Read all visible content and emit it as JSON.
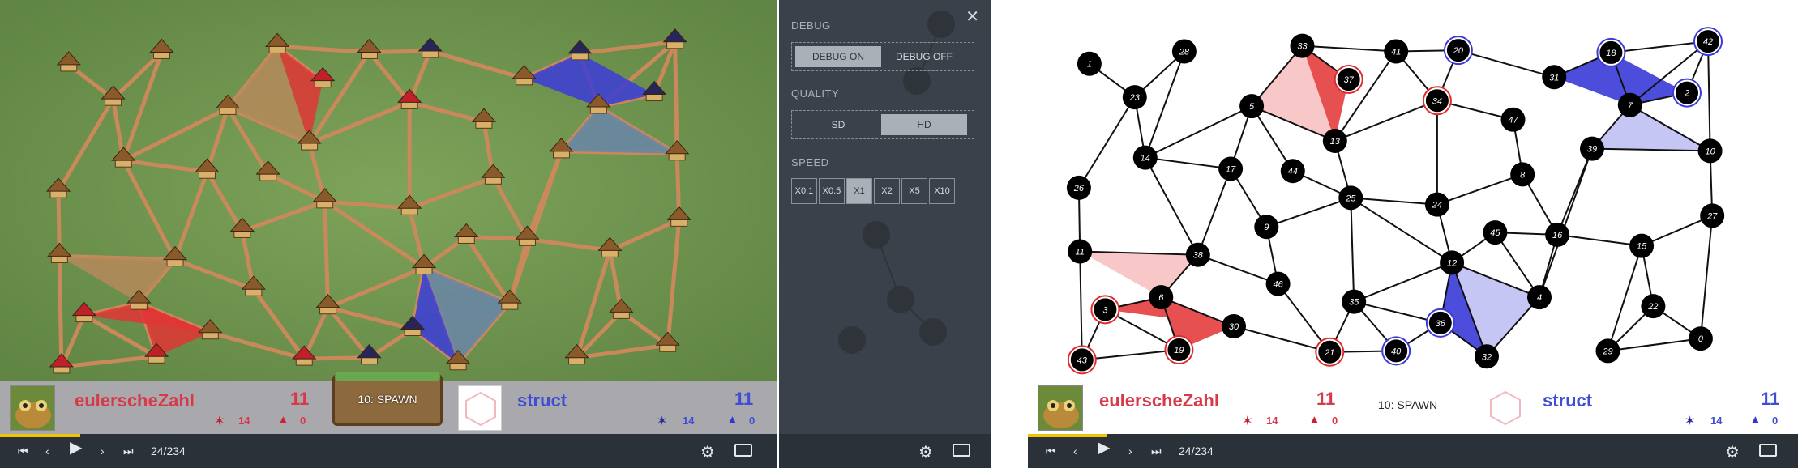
{
  "player_left": {
    "name": "eulerscheZahl",
    "score": "11",
    "units": "14",
    "ships": "0"
  },
  "player_right": {
    "name": "struct",
    "score": "11",
    "units": "14",
    "ships": "0"
  },
  "turn_label": "10: SPAWN",
  "frame_position": "24/234",
  "progress_fraction": 0.103,
  "debug_panel": {
    "debug_title": "DEBUG",
    "debug_on": "DEBUG ON",
    "debug_off": "DEBUG OFF",
    "quality_title": "QUALITY",
    "quality_sd": "SD",
    "quality_hd": "HD",
    "speed_title": "SPEED",
    "speeds": [
      "X0.1",
      "X0.5",
      "X1",
      "X2",
      "X5",
      "X10"
    ],
    "selected_speed": "X1"
  },
  "colors": {
    "red": "#e02a2a",
    "blue": "#3a3ad8",
    "node": "#000000",
    "progress": "#f5c400"
  },
  "graph": {
    "nodes": [
      {
        "id": "1"
      },
      {
        "id": "28"
      },
      {
        "id": "23"
      },
      {
        "id": "33"
      },
      {
        "id": "41"
      },
      {
        "id": "20"
      },
      {
        "id": "18"
      },
      {
        "id": "42"
      },
      {
        "id": "37"
      },
      {
        "id": "31"
      },
      {
        "id": "2"
      },
      {
        "id": "7"
      },
      {
        "id": "34"
      },
      {
        "id": "5"
      },
      {
        "id": "47"
      },
      {
        "id": "13"
      },
      {
        "id": "14"
      },
      {
        "id": "39"
      },
      {
        "id": "10"
      },
      {
        "id": "17"
      },
      {
        "id": "44"
      },
      {
        "id": "26"
      },
      {
        "id": "8"
      },
      {
        "id": "25"
      },
      {
        "id": "24"
      },
      {
        "id": "27"
      },
      {
        "id": "9"
      },
      {
        "id": "45"
      },
      {
        "id": "16"
      },
      {
        "id": "11"
      },
      {
        "id": "38"
      },
      {
        "id": "12"
      },
      {
        "id": "15"
      },
      {
        "id": "46"
      },
      {
        "id": "6"
      },
      {
        "id": "4"
      },
      {
        "id": "22"
      },
      {
        "id": "3"
      },
      {
        "id": "35"
      },
      {
        "id": "30"
      },
      {
        "id": "36"
      },
      {
        "id": "0"
      },
      {
        "id": "29"
      },
      {
        "id": "21"
      },
      {
        "id": "40"
      },
      {
        "id": "19"
      },
      {
        "id": "32"
      },
      {
        "id": "43"
      }
    ]
  }
}
